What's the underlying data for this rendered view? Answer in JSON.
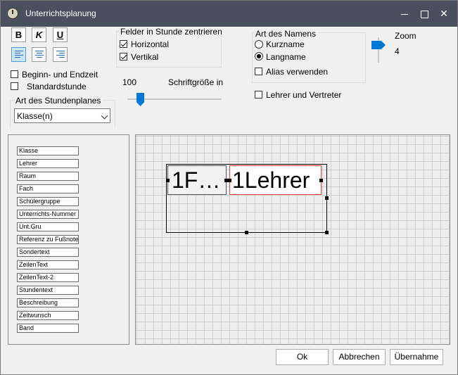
{
  "window": {
    "title": "Unterrichtsplanung"
  },
  "format": {
    "bold_label": "B",
    "italic_label": "K",
    "underline_label": "U"
  },
  "center_fields": {
    "title": "Felder in Stunde zentrieren",
    "horizontal_label": "Horizontal",
    "horizontal_checked": true,
    "vertical_label": "Vertikal",
    "vertical_checked": true
  },
  "options": {
    "begin_end_label": "Beginn- und Endzeit",
    "begin_end_checked": false,
    "standard_label": "Standardstunde",
    "standard_checked": false
  },
  "font_size": {
    "value": "100",
    "label": "Schriftgröße in"
  },
  "name_type": {
    "title": "Art des Namens",
    "short_label": "Kurzname",
    "long_label": "Langname",
    "selected": "Langname",
    "alias_label": "Alias verwenden",
    "alias_checked": false
  },
  "teacher_substitute": {
    "label": "Lehrer und Vertreter",
    "checked": false
  },
  "zoom": {
    "label": "Zoom",
    "value": "4"
  },
  "plan_type": {
    "title": "Art des Stundenplanes",
    "selected": "Klasse(n)"
  },
  "fields": [
    "Klasse",
    "Lehrer",
    "Raum",
    "Fach",
    "Schülergruppe",
    "Unterrichts-Nummer",
    "Unt.Gru",
    "Referenz zu Fußnote",
    "Sondertext",
    "ZeilenText",
    "ZeilenText-2",
    "Stundentext",
    "Beschreibung",
    "Zeitwunsch",
    "Band"
  ],
  "preview": {
    "cell1": "1F…",
    "cell2": "1Lehrer"
  },
  "buttons": {
    "ok": "Ok",
    "cancel": "Abbrechen",
    "apply": "Übernahme"
  }
}
